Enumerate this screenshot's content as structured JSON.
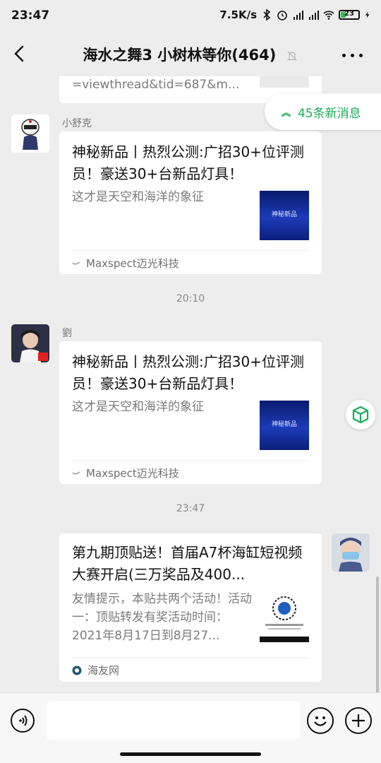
{
  "status_bar": {
    "time": "23:47",
    "net_speed": "7.5K/s",
    "battery": "23",
    "icons": [
      "bluetooth-icon",
      "alarm-icon",
      "signal-hd-icon",
      "signal-hd-icon",
      "wifi-icon",
      "battery-icon",
      "charging-icon"
    ]
  },
  "header": {
    "title": "海水之舞3 小树林等你(464)",
    "back_icon": "chevron-left-icon",
    "mute_icon": "bell-off-icon",
    "more_icon": "more-dots-icon"
  },
  "new_messages": {
    "label": "45条新消息",
    "icon": "double-chevron-up-icon"
  },
  "chat": {
    "partial_message": {
      "text": "=viewthread&tid=687&m..."
    },
    "messages": [
      {
        "sender": "小舒克",
        "title": "神秘新品丨热烈公测:广招30+位评测员！豪送30+台新品灯具！",
        "desc": "这才是天空和海洋的象征",
        "thumb_text": "神秘新品",
        "source": "Maxspect迈光科技"
      },
      {
        "timestamp": "20:10",
        "sender": "劉",
        "title": "神秘新品丨热烈公测:广招30+位评测员！豪送30+台新品灯具！",
        "desc": "这才是天空和海洋的象征",
        "thumb_text": "神秘新品",
        "source": "Maxspect迈光科技"
      },
      {
        "timestamp": "23:47",
        "sender": "",
        "title": "第九期顶贴送！首届A7杯海缸短视频大赛开启(三万奖品及400...",
        "desc": "友情提示，本贴共两个活动！活动一：顶贴转发有奖活动时间：2021年8月17日到8月27...",
        "source": "海友网"
      }
    ]
  },
  "input_bar": {
    "voice_icon": "voice-icon",
    "emoji_icon": "emoji-icon",
    "plus_icon": "plus-icon",
    "placeholder": ""
  },
  "colors": {
    "accent": "#1aad5a",
    "background": "#ededed",
    "card": "#ffffff"
  }
}
